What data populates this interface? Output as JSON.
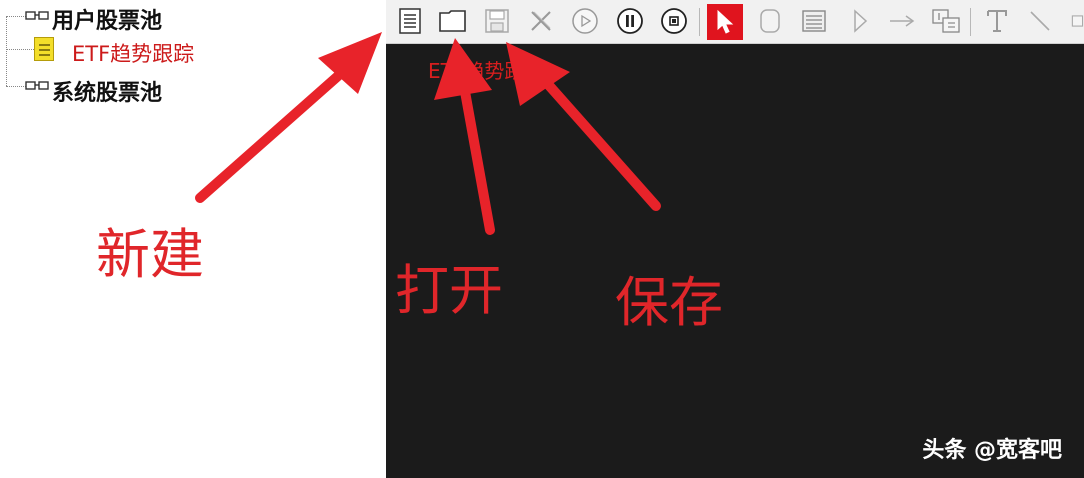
{
  "tree": {
    "groups": [
      {
        "label": "用户股票池",
        "icon": "glasses-icon"
      },
      {
        "label": "系统股票池",
        "icon": "glasses-icon"
      }
    ],
    "items": [
      {
        "label": "ETF趋势跟踪",
        "icon": "note-icon",
        "color": "#cc1a1a"
      }
    ]
  },
  "toolbar": {
    "buttons": [
      {
        "name": "new-file",
        "icon": "document-icon"
      },
      {
        "name": "open-file",
        "icon": "folder-icon"
      },
      {
        "name": "save-file",
        "icon": "floppy-disk-icon"
      },
      {
        "name": "delete",
        "icon": "cross-icon"
      },
      {
        "name": "play",
        "icon": "play-circle-icon"
      },
      {
        "name": "pause",
        "icon": "pause-circle-icon"
      },
      {
        "name": "stop",
        "icon": "stop-circle-icon"
      },
      {
        "name": "select",
        "icon": "pointer-icon",
        "active": true
      },
      {
        "name": "rounded-rect",
        "icon": "rounded-rect-icon"
      },
      {
        "name": "list-block",
        "icon": "list-block-icon"
      },
      {
        "name": "triangle",
        "icon": "triangle-icon"
      },
      {
        "name": "arrow",
        "icon": "arrow-icon"
      },
      {
        "name": "text-box",
        "icon": "text-box-icon"
      },
      {
        "name": "text-tool",
        "icon": "text-tool-icon"
      },
      {
        "name": "line-tool",
        "icon": "line-icon"
      },
      {
        "name": "rect-tool",
        "icon": "rect-icon"
      }
    ],
    "active_color": "#e0141e"
  },
  "canvas": {
    "title_text": "ETF趋势跟踪"
  },
  "annotations": {
    "new": "新建",
    "open": "打开",
    "save": "保存",
    "color": "#e0262a"
  },
  "watermark": "头条 @宽客吧"
}
